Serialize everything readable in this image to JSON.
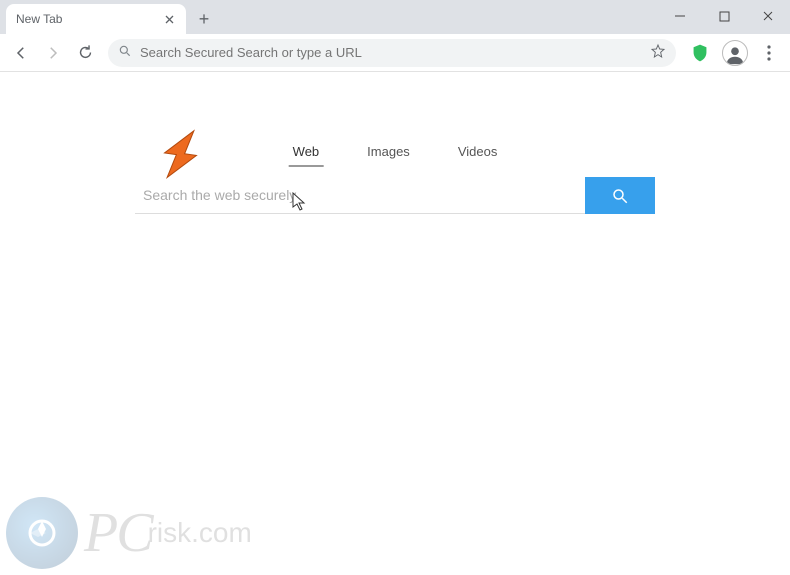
{
  "window": {
    "tab_title": "New Tab"
  },
  "omnibox": {
    "placeholder": "Search Secured Search or type a URL"
  },
  "page": {
    "tabs": {
      "web": "Web",
      "images": "Images",
      "videos": "Videos"
    },
    "search_placeholder": "Search the web securely"
  },
  "watermark": {
    "brand_prefix": "PC",
    "brand_suffix": "risk.com"
  },
  "colors": {
    "accent": "#37a0ec",
    "arrow": "#ed6a1f",
    "tabstrip": "#dee1e6",
    "omnibox_bg": "#f1f3f4"
  }
}
